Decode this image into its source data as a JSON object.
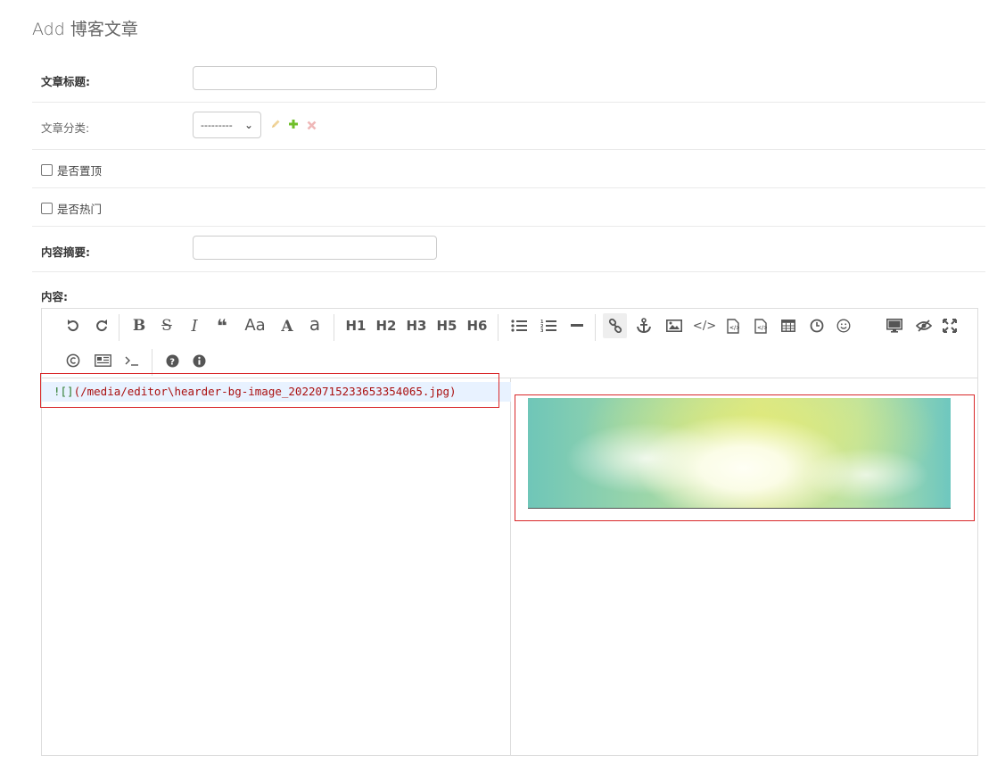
{
  "page": {
    "title": "Add 博客文章"
  },
  "fields": {
    "title_label": "文章标题:",
    "category_label": "文章分类:",
    "category_select": "---------",
    "is_top_label": "是否置顶",
    "is_hot_label": "是否热门",
    "summary_label": "内容摘要:",
    "content_label": "内容:"
  },
  "editor": {
    "toolbar_row1": {
      "undo": "undo-icon",
      "redo": "redo-icon",
      "bold": "B",
      "strike": "S",
      "italic": "I",
      "quote": "❝",
      "case_aa": "Aa",
      "upper_a": "A",
      "lower_a": "a",
      "h1": "H1",
      "h2": "H2",
      "h3": "H3",
      "h5": "H5",
      "h6": "H6"
    },
    "markdown_line": {
      "prefix": "![]",
      "url": "(/media/editor\\hearder-bg-image_20220715233653354065.jpg)"
    }
  },
  "colors": {
    "edit_icon": "#f0d49b",
    "add_icon": "#70bf2b",
    "delete_icon": "#efb8b8",
    "highlight_box": "#d9282a"
  }
}
